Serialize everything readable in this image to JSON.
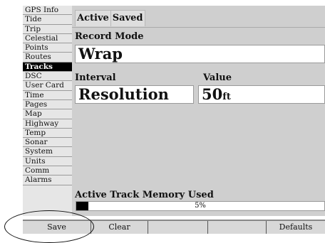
{
  "sidebar": {
    "items": [
      {
        "label": "GPS Info"
      },
      {
        "label": "Tide"
      },
      {
        "label": "Trip"
      },
      {
        "label": "Celestial"
      },
      {
        "label": "Points"
      },
      {
        "label": "Routes"
      },
      {
        "label": "Tracks"
      },
      {
        "label": "DSC"
      },
      {
        "label": "User Card"
      },
      {
        "label": "Time"
      },
      {
        "label": "Pages"
      },
      {
        "label": "Map"
      },
      {
        "label": "Highway"
      },
      {
        "label": "Temp"
      },
      {
        "label": "Sonar"
      },
      {
        "label": "System"
      },
      {
        "label": "Units"
      },
      {
        "label": "Comm"
      },
      {
        "label": "Alarms"
      }
    ],
    "selected": "Tracks"
  },
  "tabs": [
    {
      "label": "Active"
    },
    {
      "label": "Saved"
    }
  ],
  "record_mode": {
    "label": "Record Mode",
    "value": "Wrap"
  },
  "interval": {
    "label": "Interval",
    "value": "Resolution"
  },
  "value": {
    "label": "Value",
    "number": "50",
    "unit": "ft"
  },
  "memory": {
    "label": "Active Track Memory Used",
    "percent_text": "5%",
    "percent": 5
  },
  "softkeys": [
    {
      "label": "Save"
    },
    {
      "label": "Clear"
    },
    {
      "label": ""
    },
    {
      "label": ""
    },
    {
      "label": "Defaults"
    }
  ],
  "colors": {
    "selected_bg": "#000000",
    "panel_bg": "#cfcfcf",
    "field_bg": "#ffffff"
  }
}
